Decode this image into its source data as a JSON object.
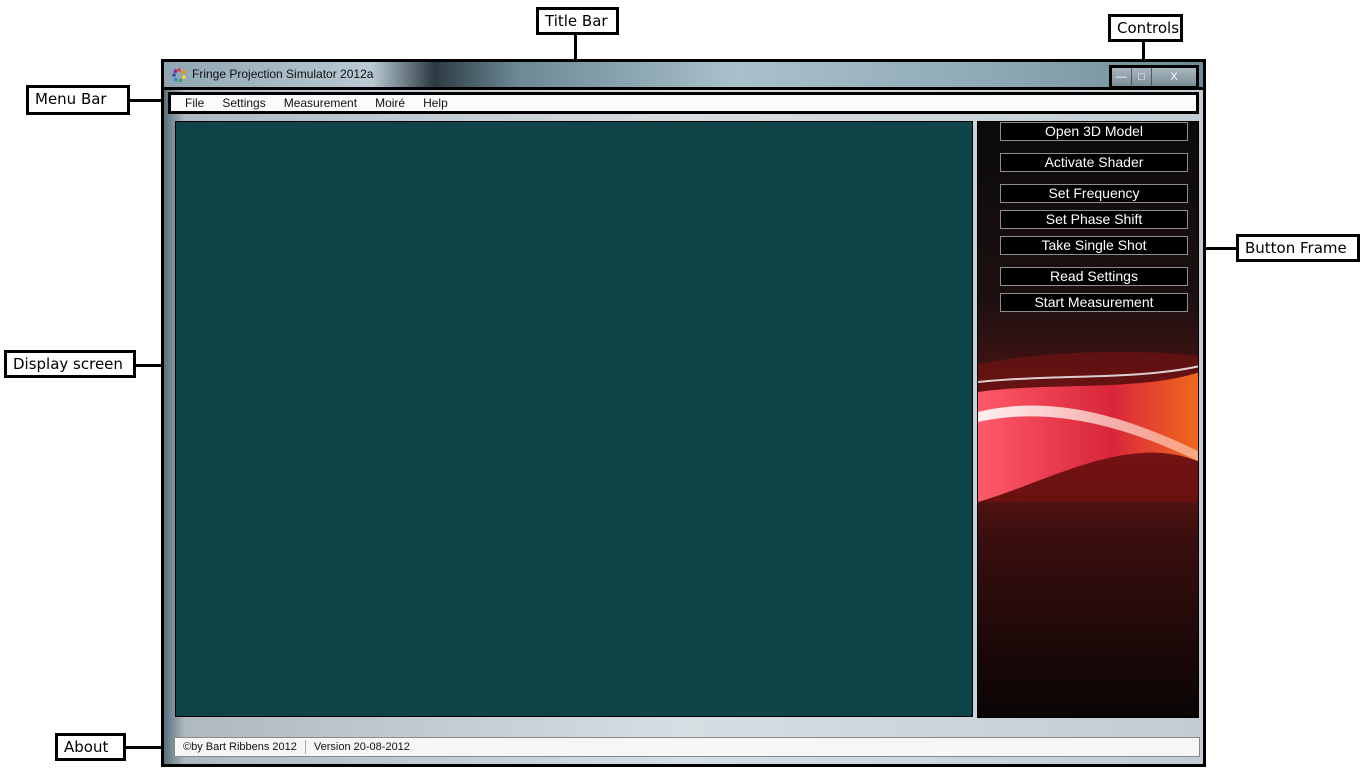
{
  "callouts": {
    "title_bar": "Title Bar",
    "controls": "Controls",
    "menu_bar": "Menu Bar",
    "button_frame": "Button Frame",
    "display_screen": "Display screen",
    "about": "About"
  },
  "window": {
    "title": "Fringe Projection Simulator 2012a",
    "controls": {
      "minimize": "—",
      "maximize": "□",
      "close": "X"
    }
  },
  "menu": {
    "items": [
      "File",
      "Settings",
      "Measurement",
      "Moiré",
      "Help"
    ]
  },
  "buttons": [
    "Open 3D Model",
    "Activate Shader",
    "Set Frequency",
    "Set Phase Shift",
    "Take Single Shot",
    "Read Settings",
    "Start Measurement"
  ],
  "status": {
    "author": "©by Bart Ribbens 2012",
    "version": "Version 20-08-2012"
  },
  "colors": {
    "display": "#0f4448",
    "button_bg": "#000000",
    "accent_red": "#d8263a"
  }
}
